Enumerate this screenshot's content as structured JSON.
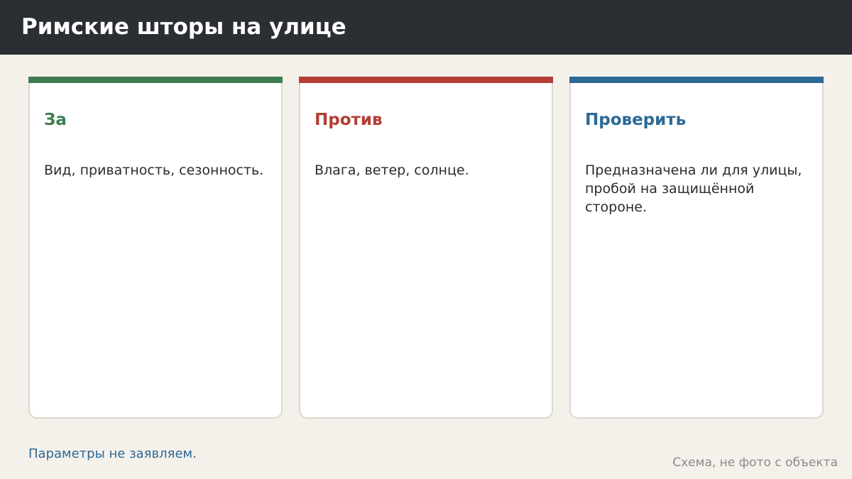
{
  "header": {
    "title": "Римские шторы на улице",
    "background_color": "#2b2e33"
  },
  "cards": [
    {
      "heading": "За",
      "text": "Вид, приватность, сезонность.",
      "accent_color": "#3e7d4f"
    },
    {
      "heading": "Против",
      "text": "Влага, ветер, солнце.",
      "accent_color": "#b43e35"
    },
    {
      "heading": "Проверить",
      "text": "Предназначена ли для улицы, пробой на защищённой стороне.",
      "accent_color": "#2d6a96"
    }
  ],
  "footer": {
    "note": "Параметры не заявляем.",
    "caption": "Схема, не фото с объекта"
  },
  "colors": {
    "page_background": "#f4f1eb",
    "card_background": "#ffffff",
    "note_color": "#2d6a96",
    "caption_color": "#8a8a8a"
  }
}
